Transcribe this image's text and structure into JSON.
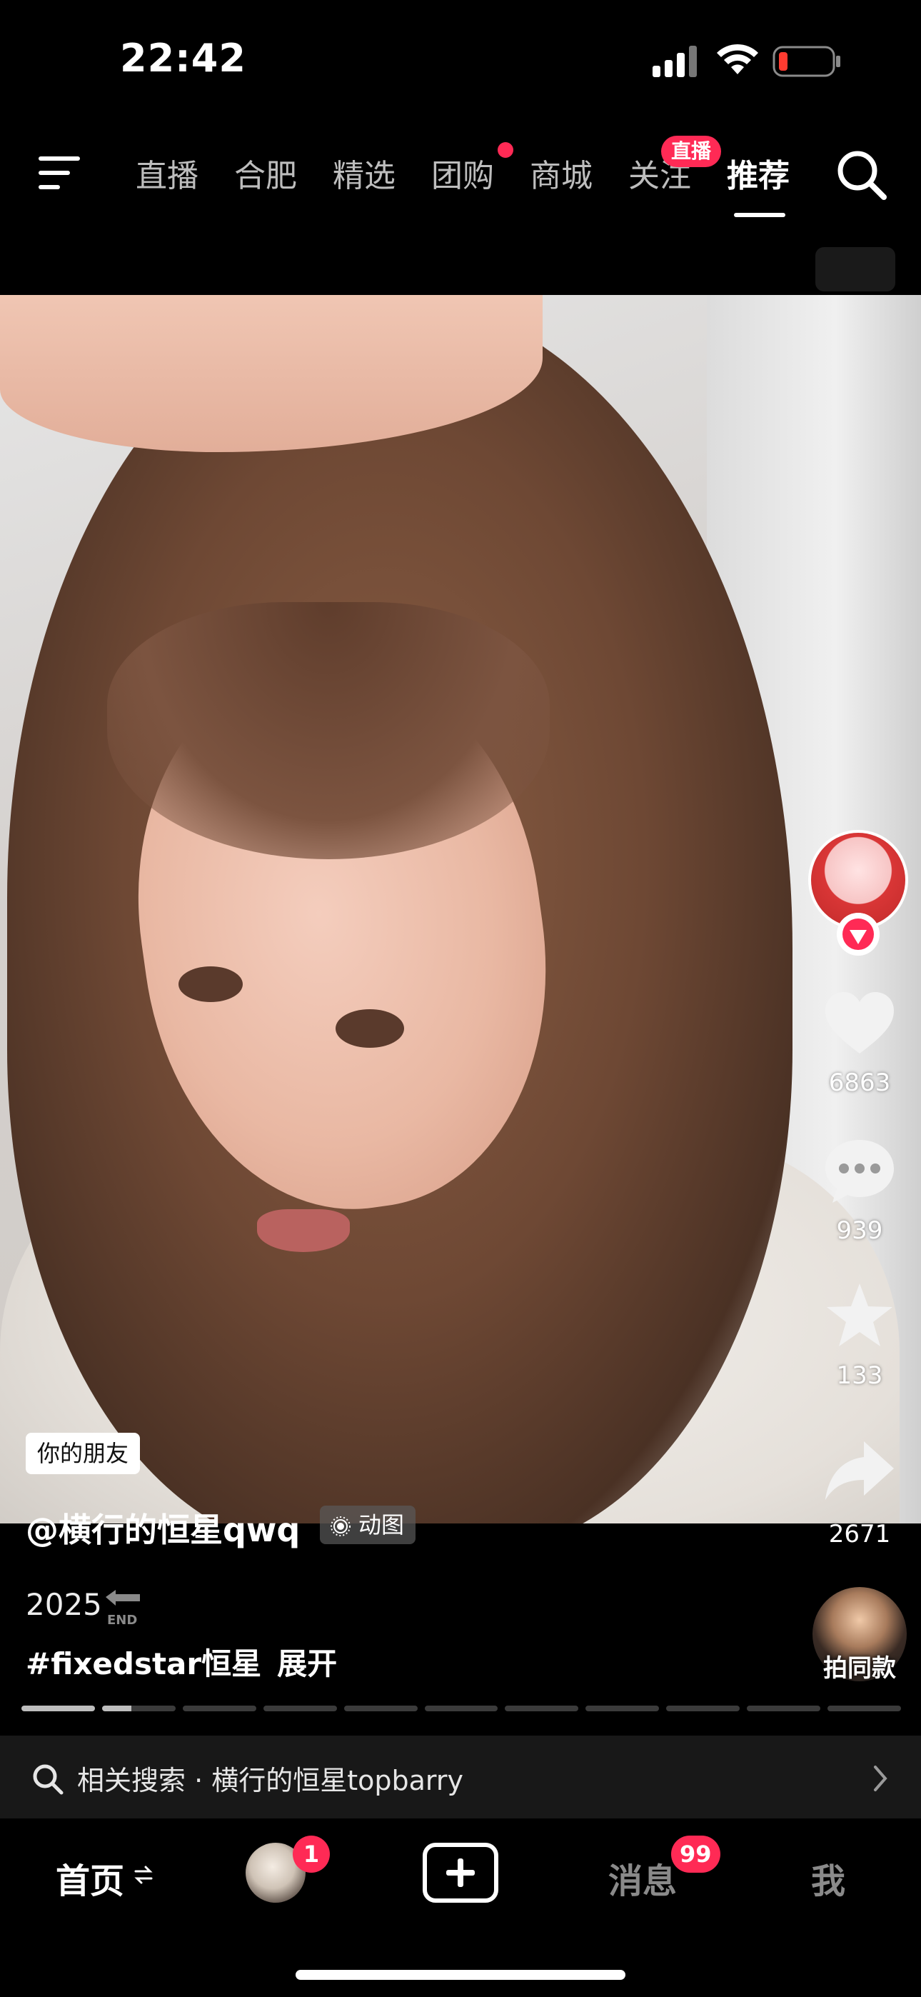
{
  "status_bar": {
    "time": "22:42",
    "icons": [
      "signal-icon",
      "wifi-icon",
      "battery-low-icon"
    ]
  },
  "top_nav": {
    "tabs": [
      "直播",
      "合肥",
      "精选",
      "团购",
      "商城",
      "关注",
      "推荐"
    ],
    "active_tab": "推荐",
    "live_badge": "直播",
    "icons": [
      "menu-icon",
      "search-icon"
    ]
  },
  "video": {
    "friend_badge": "你的朋友",
    "author_handle": "@横行的恒星qwq",
    "motion_badge": "动图",
    "caption_year": "2025",
    "hashtag": "#fixedstar恒星",
    "expand_label": "展开"
  },
  "actions": {
    "likes": "6863",
    "comments": "939",
    "favorites": "133",
    "shares": "2671",
    "same_style_label": "拍同款"
  },
  "progress": {
    "segments_total": 11,
    "segments_done": 1,
    "current_segment_progress": 0.4
  },
  "related_search": {
    "text": "相关搜索 · 横行的恒星topbarry"
  },
  "bottom_nav": {
    "home": "首页",
    "friend_badge_count": "1",
    "messages": "消息",
    "messages_badge": "99",
    "me": "我"
  },
  "colors": {
    "accent": "#ff2a55",
    "background": "#000000"
  }
}
